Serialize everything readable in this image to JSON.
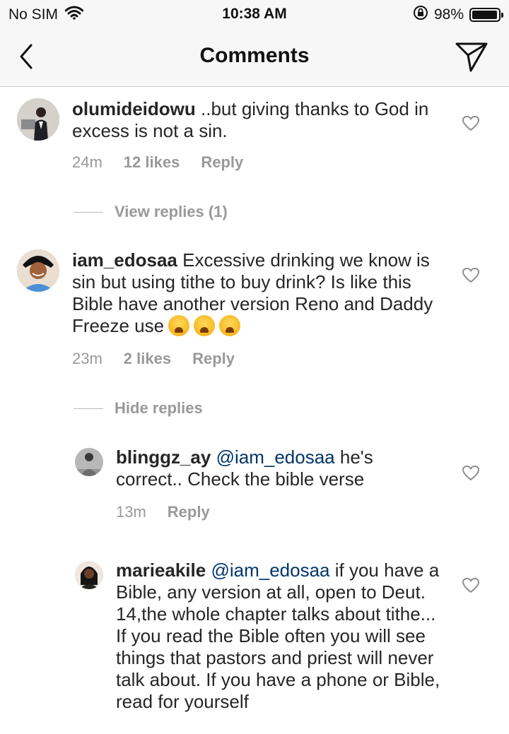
{
  "status_bar": {
    "carrier": "No SIM",
    "time": "10:38 AM",
    "battery": "98%",
    "battery_level": 0.98
  },
  "nav": {
    "title": "Comments"
  },
  "comments": [
    {
      "username": "olumideidowu",
      "text": "..but giving thanks to God in excess is not a sin.",
      "time": "24m",
      "likes": "12 likes",
      "reply_label": "Reply",
      "toggle": "View replies (1)"
    },
    {
      "username": "iam_edosaa",
      "text": "Excessive drinking we know is sin but using tithe to buy drink? Is like this Bible have another version Reno and Daddy Freeze use",
      "emojis": "😭😭😭",
      "time": "23m",
      "likes": "2 likes",
      "reply_label": "Reply",
      "toggle": "Hide replies"
    }
  ],
  "replies": [
    {
      "username": "blinggz_ay",
      "mention": "@iam_edosaa",
      "text": "he's correct.. Check the bible verse",
      "time": "13m",
      "reply_label": "Reply"
    },
    {
      "username": "marieakile",
      "mention": "@iam_edosaa",
      "text": "if you have a Bible, any version at all, open to Deut. 14,the whole chapter talks about tithe... If you read the Bible often you will see things that pastors and priest will never talk about. If you have a phone or Bible, read for yourself"
    }
  ]
}
